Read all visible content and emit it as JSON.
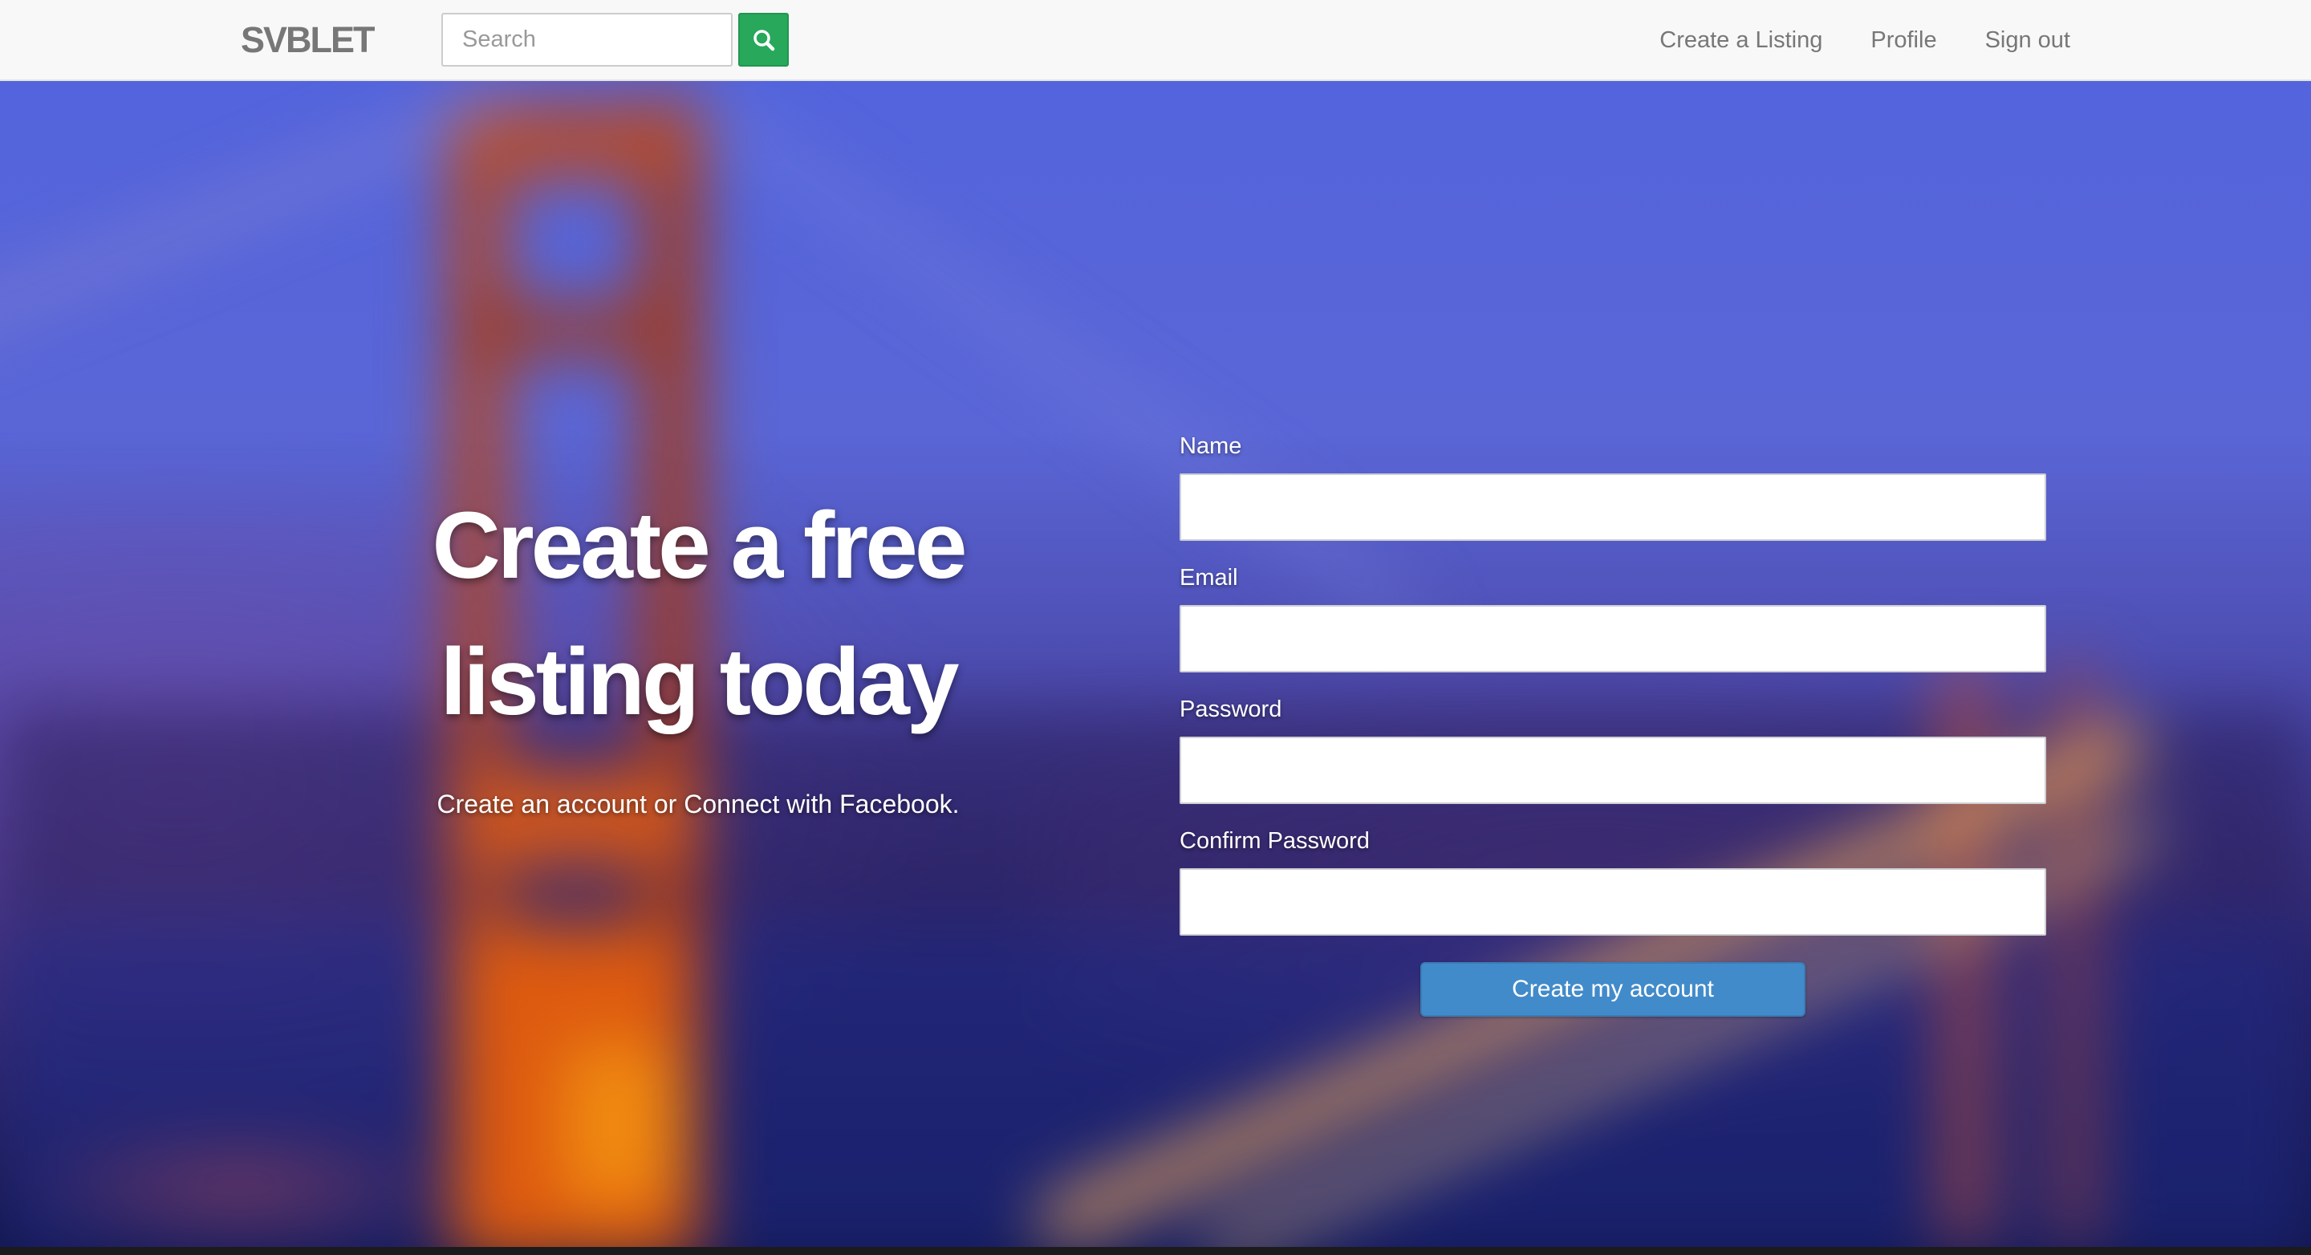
{
  "navbar": {
    "brand": "SVBLET",
    "search": {
      "placeholder": "Search",
      "value": ""
    },
    "links": [
      "Create a Listing",
      "Profile",
      "Sign out"
    ]
  },
  "hero": {
    "headline_line1": "Create a free",
    "headline_line2": "listing today",
    "subtext": "Create an account or Connect with Facebook."
  },
  "form": {
    "fields": [
      {
        "label": "Name",
        "value": ""
      },
      {
        "label": "Email",
        "value": ""
      },
      {
        "label": "Password",
        "value": ""
      },
      {
        "label": "Confirm Password",
        "value": ""
      }
    ],
    "submit_label": "Create my account"
  },
  "icons": {
    "search_button": "search-icon"
  },
  "colors": {
    "search_button": "#27a85a",
    "submit_button": "#428bca",
    "navbar_bg": "#f8f8f8",
    "nav_text": "#777777"
  }
}
